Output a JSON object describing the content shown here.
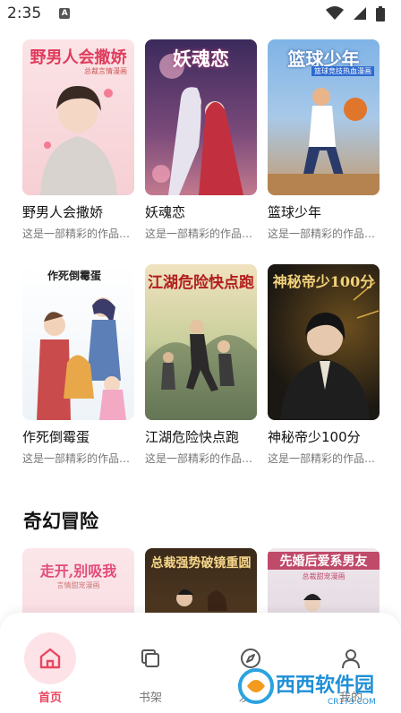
{
  "status_bar": {
    "time": "2:35",
    "notification_icon": "A"
  },
  "books_row1": [
    {
      "title": "野男人会撒娇",
      "desc": "这是一部精彩的作品…",
      "cover_text": "野男人会撒娇",
      "cover_sub": "总裁言情漫画"
    },
    {
      "title": "妖魂恋",
      "desc": "这是一部精彩的作品…",
      "cover_text": "妖魂恋"
    },
    {
      "title": "篮球少年",
      "desc": "这是一部精彩的作品…",
      "cover_text": "篮球少年",
      "cover_sub": "篮球竞技热血漫画"
    }
  ],
  "books_row2": [
    {
      "title": "作死倒霉蛋",
      "desc": "这是一部精彩的作品…",
      "cover_text": "作死倒霉蛋"
    },
    {
      "title": "江湖危险快点跑",
      "desc": "这是一部精彩的作品…",
      "cover_text": "江湖危险快点跑"
    },
    {
      "title": "神秘帝少100分",
      "desc": "这是一部精彩的作品…",
      "cover_text": "神秘帝少100分"
    }
  ],
  "section": {
    "title": "奇幻冒险"
  },
  "books_row3": [
    {
      "cover_text": "走开,别吸我",
      "cover_sub": "言情甜宠漫画"
    },
    {
      "cover_text": "总裁强势破镜重圆"
    },
    {
      "cover_text": "先婚后爱系男友",
      "cover_sub": "总裁甜宠漫画"
    }
  ],
  "nav": [
    {
      "label": "首页",
      "icon": "home-icon",
      "active": true
    },
    {
      "label": "书架",
      "icon": "bookshelf-icon",
      "active": false
    },
    {
      "label": "发现",
      "icon": "compass-icon",
      "active": false
    },
    {
      "label": "我的",
      "icon": "user-icon",
      "active": false
    }
  ],
  "watermark": {
    "text": "西西软件园",
    "sub": "CR173.COM"
  },
  "colors": {
    "accent": "#e8475f",
    "accent_bg": "#fde3e8"
  }
}
